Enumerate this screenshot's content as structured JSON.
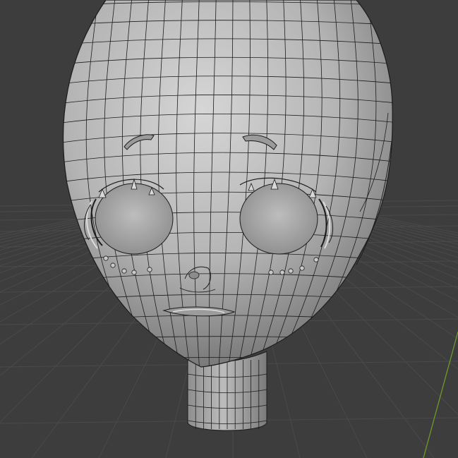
{
  "viewport": {
    "background_color": "#3d3d3d",
    "grid_color": "#4a4a4a",
    "axis_y_color": "#6b9a2a"
  },
  "mesh": {
    "base_color": "#b4b4b4",
    "highlight_color": "#d6d6d6",
    "shadow_color": "#6f6f6f",
    "wire_color": "#1c1c1c"
  }
}
